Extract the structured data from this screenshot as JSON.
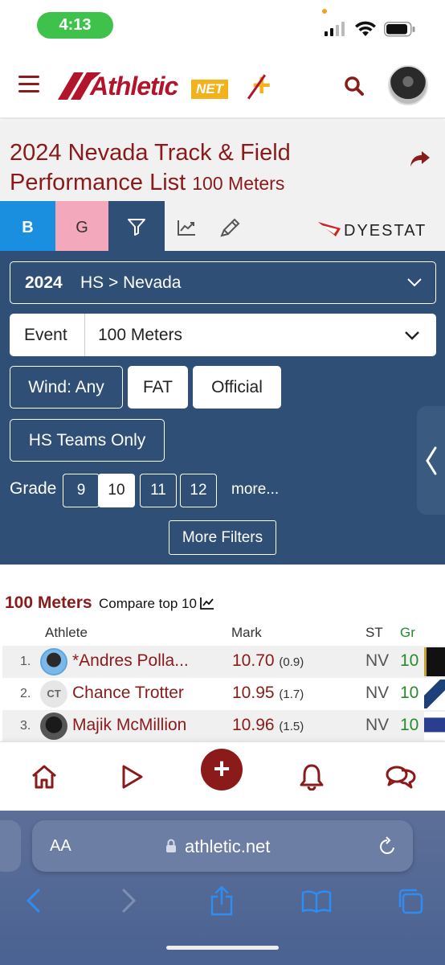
{
  "status_bar": {
    "time": "4:13"
  },
  "header": {
    "logo_main": "Athletic",
    "logo_net": "NET",
    "logo_plus": "+"
  },
  "page": {
    "title": "2024 Nevada Track & Field Performance List",
    "subtitle": "100 Meters"
  },
  "tabs": {
    "boys": "B",
    "girls": "G",
    "dyestat": "DYESTAT"
  },
  "filters": {
    "season_year": "2024",
    "season_scope": "HS > Nevada",
    "event_label": "Event",
    "event_value": "100 Meters",
    "wind": "Wind: Any",
    "fat": "FAT",
    "official": "Official",
    "hs_teams_only": "HS Teams Only",
    "grade_label": "Grade",
    "grades": [
      "9",
      "10",
      "11",
      "12"
    ],
    "grade_selected": "10",
    "more": "more...",
    "more_filters": "More Filters"
  },
  "results": {
    "title": "100 Meters",
    "compare": "Compare top 10",
    "columns": {
      "athlete": "Athlete",
      "mark": "Mark",
      "st": "ST",
      "gr": "Gr"
    },
    "rows": [
      {
        "rank": "1.",
        "name": "*Andres Polla...",
        "mark": "10.70",
        "wind": "(0.9)",
        "st": "NV",
        "gr": "10"
      },
      {
        "rank": "2.",
        "initials": "CT",
        "name": "Chance Trotter",
        "mark": "10.95",
        "wind": "(1.7)",
        "st": "NV",
        "gr": "10"
      },
      {
        "rank": "3.",
        "name": "Majik McMillion",
        "mark": "10.96",
        "wind": "(1.5)",
        "st": "NV",
        "gr": "10"
      }
    ]
  },
  "browser": {
    "text_size": "AA",
    "url": "athletic.net"
  },
  "colors": {
    "brand": "#8b1a1a",
    "panel": "#2f4f77",
    "boys_tab": "#1a8fe0",
    "girls_tab": "#f4a8bb",
    "grade_color": "#2a8a2a"
  }
}
